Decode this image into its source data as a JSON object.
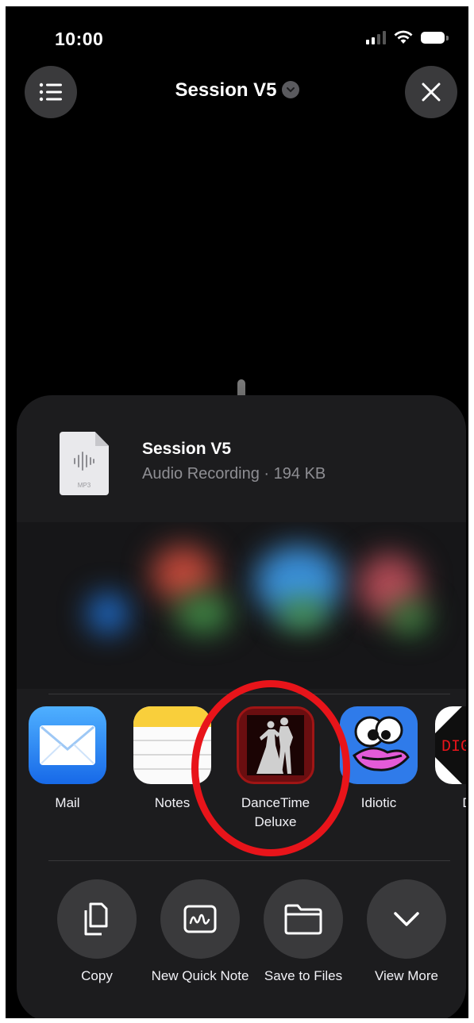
{
  "status_bar": {
    "time": "10:00"
  },
  "header": {
    "title": "Session V5",
    "menu_icon": "list-icon",
    "close_icon": "close-icon"
  },
  "share_sheet": {
    "file": {
      "name": "Session V5",
      "subtitle": "Audio Recording · 194 KB",
      "type_label": "MP3",
      "icon": "audio-file-icon"
    },
    "apps": [
      {
        "label": "Mail",
        "icon": "mail-icon"
      },
      {
        "label": "Notes",
        "icon": "notes-icon"
      },
      {
        "label": "DanceTime Deluxe",
        "icon": "dancetime-deluxe-icon"
      },
      {
        "label": "Idiotic",
        "icon": "idiotic-icon"
      },
      {
        "label": "Digi",
        "icon": "digi-icon"
      }
    ],
    "actions": [
      {
        "label": "Copy",
        "icon": "copy-icon"
      },
      {
        "label": "New Quick Note",
        "icon": "quick-note-icon"
      },
      {
        "label": "Save to Files",
        "icon": "folder-icon"
      },
      {
        "label": "View More",
        "icon": "chevron-down-icon"
      }
    ]
  },
  "annotation": {
    "color": "#e8141a"
  }
}
